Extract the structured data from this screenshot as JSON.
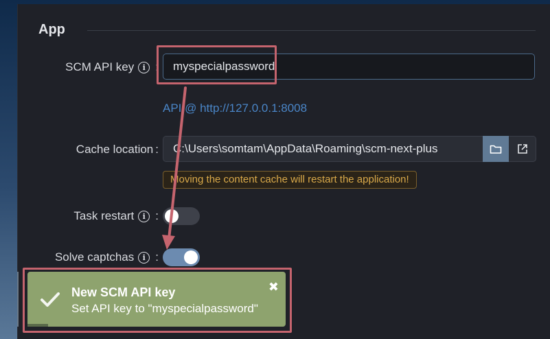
{
  "section": {
    "title": "App"
  },
  "api_key": {
    "label": "SCM API key",
    "info_symbol": "i",
    "colon": ":",
    "value": "myspecialpassword",
    "link": "API @ http://127.0.0.1:8008"
  },
  "cache": {
    "label": "Cache location",
    "colon": ":",
    "value": "C:\\Users\\somtam\\AppData\\Roaming\\scm-next-plus",
    "folder_icon": "folder-icon",
    "external_icon": "external-link-icon",
    "warning": "Moving the content cache will restart the application!"
  },
  "task_restart": {
    "label": "Task restart",
    "info_symbol": "i",
    "colon": ":",
    "enabled": false
  },
  "solve_captchas": {
    "label": "Solve captchas",
    "info_symbol": "i",
    "colon": ":",
    "enabled": true
  },
  "toast": {
    "title": "New SCM API key",
    "message": "Set API key to \"myspecialpassword\"",
    "close_symbol": "✖",
    "icon": "checkmark-icon"
  },
  "colors": {
    "accent": "#6c8bb0",
    "annotation": "#c5646e",
    "toast_bg": "#8ea36e",
    "link": "#4a86c8",
    "warning": "#d9a94a"
  }
}
